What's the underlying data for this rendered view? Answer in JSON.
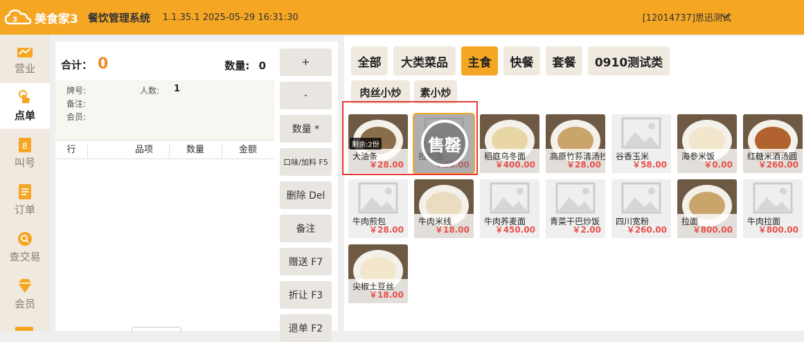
{
  "app": {
    "logo_text": "美食家3",
    "title": "餐饮管理系统",
    "version_time": "1.1.35.1 2025-05-29 16:31:30",
    "user": "[12014737]思迅测试",
    "accent_color": "#f5a623"
  },
  "sidebar": {
    "items": [
      {
        "label": "营业",
        "icon": "chart-icon"
      },
      {
        "label": "点单",
        "icon": "tap-icon",
        "active": true
      },
      {
        "label": "叫号",
        "icon": "number-icon"
      },
      {
        "label": "订单",
        "icon": "document-icon"
      },
      {
        "label": "查交易",
        "icon": "search-coin-icon"
      },
      {
        "label": "会员",
        "icon": "diamond-icon"
      }
    ]
  },
  "order": {
    "total_label": "合计：",
    "total_value": "0",
    "qty_label": "数量:",
    "qty_value": "0",
    "plate_label": "牌号:",
    "people_label": "人数:",
    "people_value": "1",
    "note_label": "备注:",
    "member_label": "会员:",
    "columns": [
      "行",
      "品项",
      "数量",
      "金额"
    ]
  },
  "actions": {
    "buttons": [
      "+",
      "-",
      "数量 *",
      "口味/加料 F5",
      "删除 Del",
      "备注",
      "赠送 F7",
      "折让 F3",
      "退单 F2"
    ]
  },
  "categories": {
    "row1": [
      "全部",
      "大类菜品",
      "主食",
      "快餐",
      "套餐",
      "0910测试类"
    ],
    "row2": [
      "肉丝小炒",
      "素小炒"
    ],
    "active": "主食"
  },
  "dishes": [
    {
      "name": "大油条",
      "price": "￥28.00",
      "remain": "剩余:2份",
      "photo": true
    },
    {
      "name": "担担面",
      "price": "￥28.00",
      "soldout": "售罄",
      "photo": false
    },
    {
      "name": "稻庭乌冬面",
      "price": "￥400.00",
      "photo": true
    },
    {
      "name": "高原竹荪清汤抄手",
      "price": "￥28.00",
      "photo": true
    },
    {
      "name": "谷香玉米",
      "price": "￥58.00",
      "photo": false
    },
    {
      "name": "海参米饭",
      "price": "￥0.00",
      "photo": true
    },
    {
      "name": "红糖米酒汤圆",
      "price": "￥260.00",
      "photo": true
    },
    {
      "name": "牛肉煎包",
      "price": "￥28.00",
      "photo": false
    },
    {
      "name": "牛肉米线",
      "price": "￥18.00",
      "photo": true
    },
    {
      "name": "牛肉荞麦面",
      "price": "￥450.00",
      "photo": false
    },
    {
      "name": "青菜干巴炒饭",
      "price": "￥2.00",
      "photo": false
    },
    {
      "name": "四川宽粉",
      "price": "￥260.00",
      "photo": false
    },
    {
      "name": "拉面",
      "price": "￥800.00",
      "photo": true
    },
    {
      "name": "牛肉拉面",
      "price": "￥800.00",
      "photo": false
    },
    {
      "name": "尖椒土豆丝",
      "price": "￥18.00",
      "photo": true
    }
  ]
}
